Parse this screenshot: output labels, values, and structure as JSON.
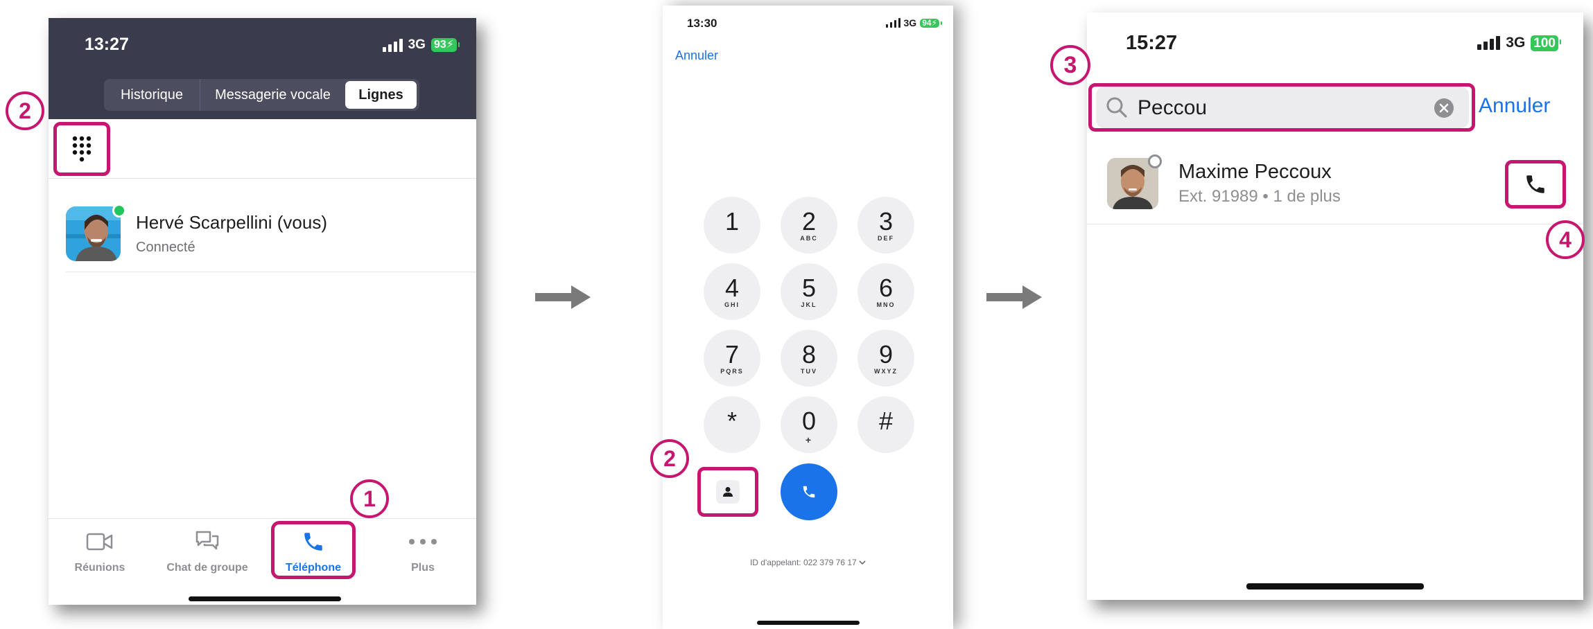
{
  "colors": {
    "accent": "#c6166f",
    "blue": "#1a73e8",
    "header": "#3a3b4d",
    "battery": "#34c759",
    "online": "#22c55e"
  },
  "steps": {
    "one": "1",
    "two": "2",
    "three": "3",
    "four": "4"
  },
  "screen1": {
    "time": "13:27",
    "network": "3G",
    "battery": "93",
    "tabs": [
      "Historique",
      "Messagerie vocale",
      "Lignes"
    ],
    "active_tab": "Lignes",
    "dialpad_icon": "dialpad-icon",
    "user": {
      "name": "Hervé Scarpellini (vous)",
      "status": "Connecté"
    },
    "bottom_nav": [
      {
        "label": "Réunions",
        "icon": "video-icon"
      },
      {
        "label": "Chat de groupe",
        "icon": "chat-icon"
      },
      {
        "label": "Téléphone",
        "icon": "phone-icon",
        "active": true
      },
      {
        "label": "Plus",
        "icon": "more-icon"
      }
    ]
  },
  "screen2": {
    "time": "13:30",
    "network": "3G",
    "battery": "94",
    "cancel": "Annuler",
    "keys": [
      {
        "digit": "1",
        "letters": ""
      },
      {
        "digit": "2",
        "letters": "ABC"
      },
      {
        "digit": "3",
        "letters": "DEF"
      },
      {
        "digit": "4",
        "letters": "GHI"
      },
      {
        "digit": "5",
        "letters": "JKL"
      },
      {
        "digit": "6",
        "letters": "MNO"
      },
      {
        "digit": "7",
        "letters": "PQRS"
      },
      {
        "digit": "8",
        "letters": "TUV"
      },
      {
        "digit": "9",
        "letters": "WXYZ"
      },
      {
        "digit": "*",
        "letters": ""
      },
      {
        "digit": "0",
        "letters": "+"
      },
      {
        "digit": "#",
        "letters": ""
      }
    ],
    "contacts_icon": "contacts-icon",
    "call_icon": "phone-icon",
    "caller_id": "ID d'appelant: 022 379 76 17"
  },
  "screen3": {
    "time": "15:27",
    "network": "3G",
    "battery": "100",
    "search_value": "Peccou",
    "cancel": "Annuler",
    "result": {
      "name": "Maxime Peccoux",
      "detail": "Ext. 91989 • 1 de plus"
    }
  }
}
